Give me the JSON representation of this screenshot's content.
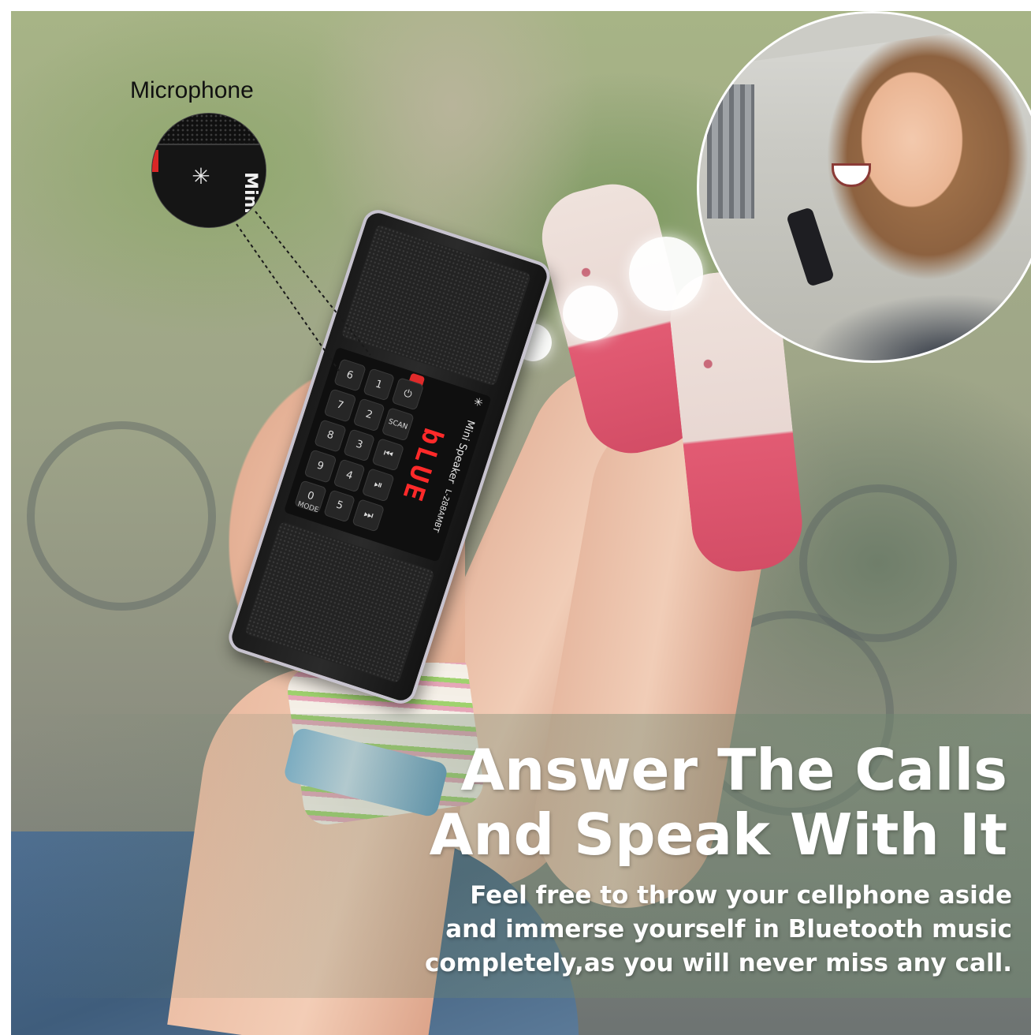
{
  "callout": {
    "label": "Microphone",
    "zoom_text": "Mini"
  },
  "device": {
    "brand_text": "Mini Speaker",
    "model": "L-288AMBT",
    "display": "bLUE",
    "keys": [
      "6",
      "1",
      "⏻",
      "7",
      "2",
      "SCAN",
      "8",
      "3",
      "⏮",
      "9",
      "4",
      "⏯",
      "0",
      "5",
      "⏭"
    ],
    "mode_label": "MODE"
  },
  "headline": {
    "line1": "Answer The Calls",
    "line2": "And Speak With It"
  },
  "body": {
    "line1": "Feel free to throw your cellphone aside",
    "line2": "and immerse yourself in Bluetooth music",
    "line3": "completely,as you will never miss any call."
  },
  "colors": {
    "display_red": "#ff2a2a",
    "text_white": "#ffffff",
    "label_black": "#111111"
  }
}
